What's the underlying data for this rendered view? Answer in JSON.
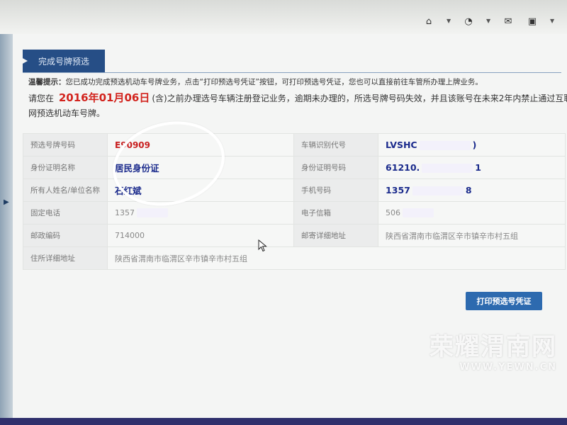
{
  "toolbar": {
    "icons": [
      "home-icon",
      "rss-icon",
      "mail-icon",
      "printer-icon"
    ],
    "home_glyph": "⌂",
    "rss_glyph": "◔",
    "mail_glyph": "✉",
    "print_glyph": "▣",
    "dropdown_glyph": "▼"
  },
  "sidebar": {
    "arrow_glyph": "▶"
  },
  "page": {
    "title": "完成号牌预选",
    "notice_label": "温馨提示：",
    "notice_text": "您已成功完成预选机动车号牌业务，点击“打印预选号凭证”按钮，可打印预选号凭证，您也可以直接前往车管所办理上牌业务。",
    "deadline_prefix": "请您在",
    "deadline_date": "2016年01月06日",
    "deadline_suffix": "(含)之前办理选号车辆注册登记业务，逾期未办理的，所选号牌号码失效，并且该账号在未来2年内禁止通过互联网预选机动车号牌。"
  },
  "fields": {
    "plate_label": "预选号牌号码",
    "plate_value": "E90909",
    "vin_label": "车辆识别代号",
    "vin_value_start": "LVSHC",
    "vin_value_end": ")",
    "id_type_label": "身份证明名称",
    "id_type_value": "居民身份证",
    "id_number_label": "身份证明号码",
    "id_number_start": "61210.",
    "id_number_end": "1",
    "owner_label": "所有人姓名/单位名称",
    "owner_value": "石红斌",
    "mobile_label": "手机号码",
    "mobile_start": "1357",
    "mobile_end": "8",
    "phone_label": "固定电话",
    "phone_value": "1357",
    "email_label": "电子信箱",
    "email_value": "506",
    "postcode_label": "邮政编码",
    "postcode_value": "714000",
    "mailing_address_label": "邮寄详细地址",
    "mailing_address_value": "陕西省渭南市临渭区辛市镇辛市村五组",
    "home_address_label": "住所详细地址",
    "home_address_value": "陕西省渭南市临渭区辛市镇辛市村五组"
  },
  "actions": {
    "print_button": "打印预选号凭证"
  },
  "watermark": {
    "title": "荣耀渭南网",
    "url": "WWW.YEWN.CN"
  }
}
